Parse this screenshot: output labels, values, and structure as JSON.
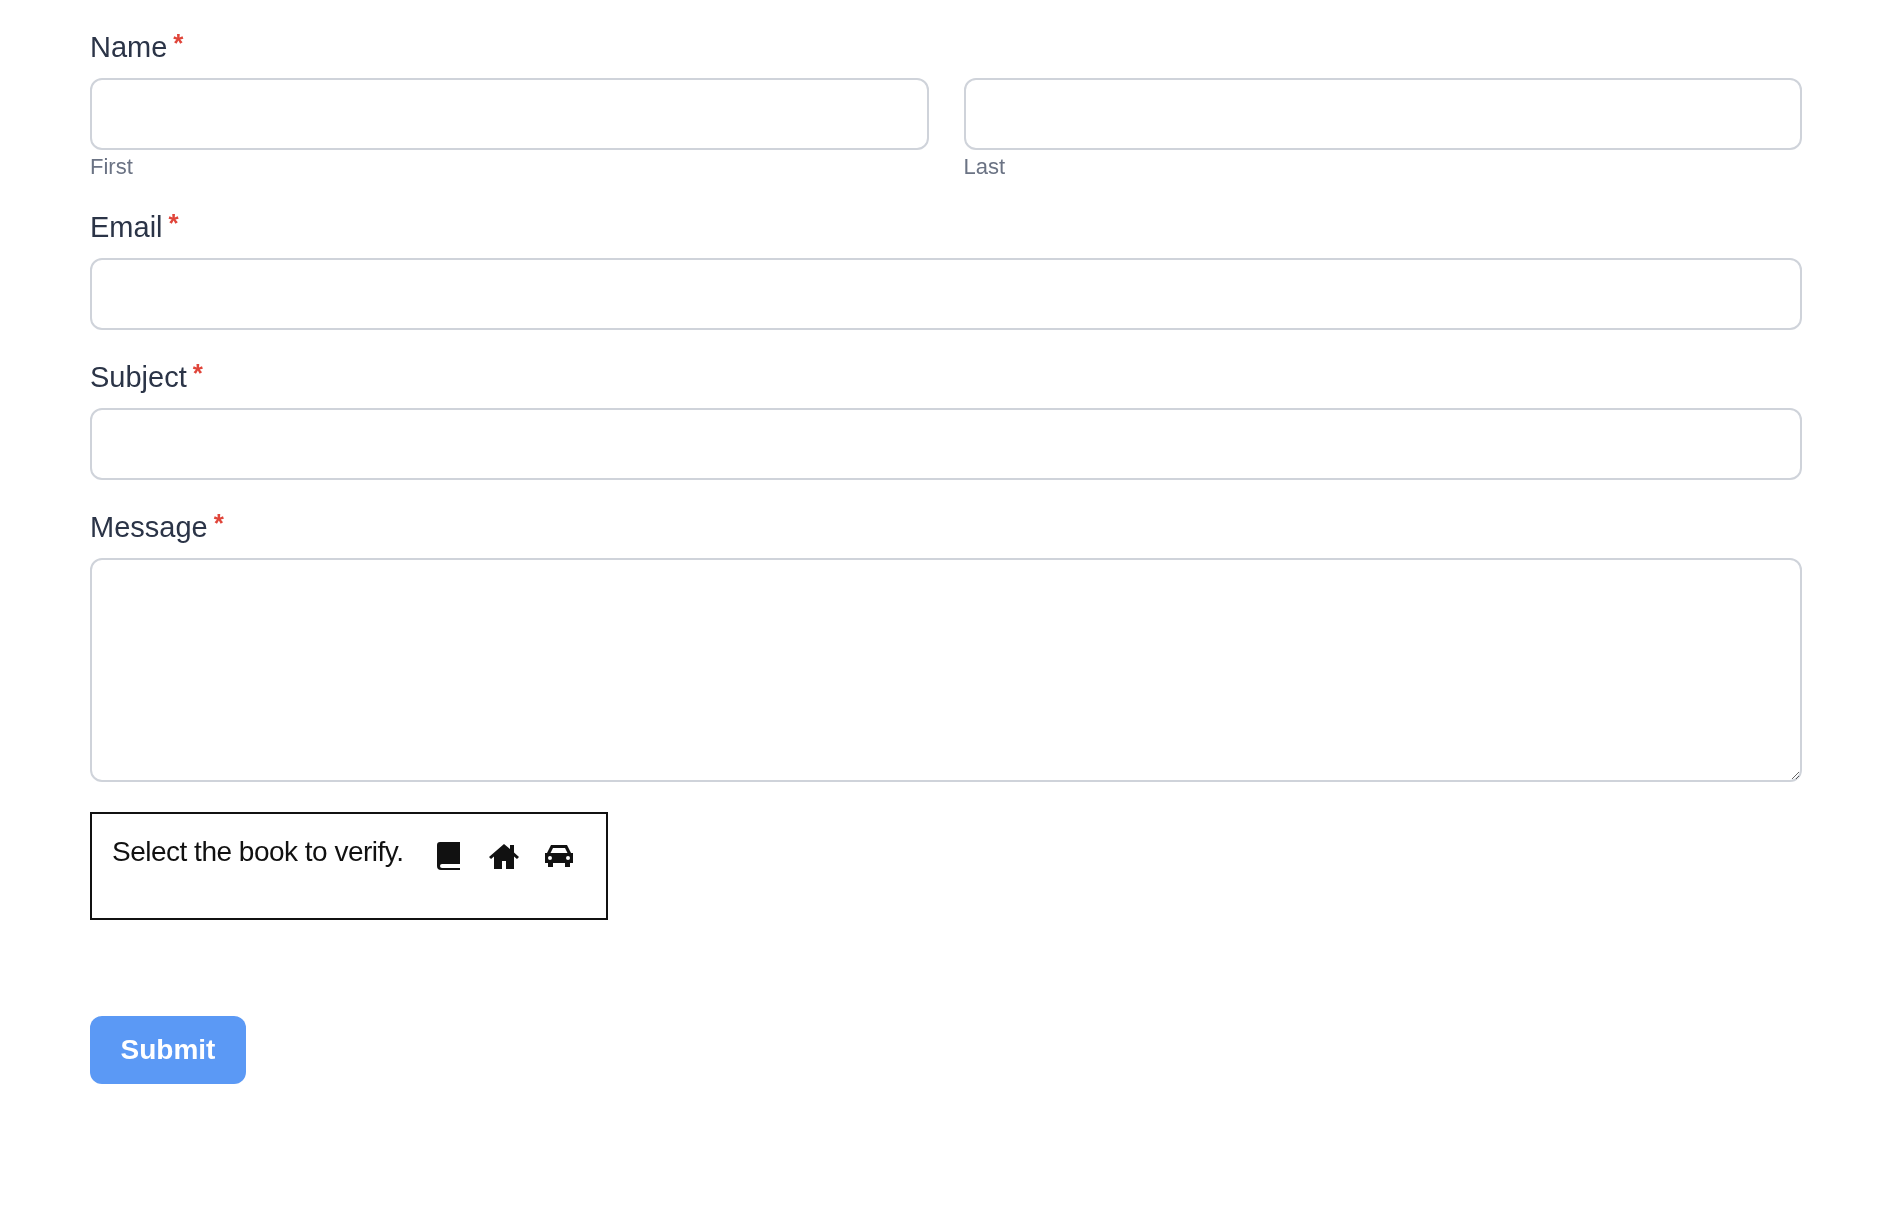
{
  "fields": [
    {
      "kind": "name",
      "label": "Name",
      "marker": "*",
      "inputs": [
        {
          "sublabel": "First"
        },
        {
          "sublabel": "Last"
        }
      ]
    },
    {
      "kind": "text",
      "label": "Email",
      "marker": "*"
    },
    {
      "kind": "text",
      "label": "Subject",
      "marker": "*"
    },
    {
      "kind": "textarea",
      "label": "Message",
      "marker": "*"
    }
  ],
  "captcha": {
    "prompt": "Select the book to verify.",
    "options": [
      {
        "kind": "book"
      },
      {
        "kind": "house"
      },
      {
        "kind": "car"
      }
    ]
  },
  "submit": {
    "label": "Submit"
  }
}
